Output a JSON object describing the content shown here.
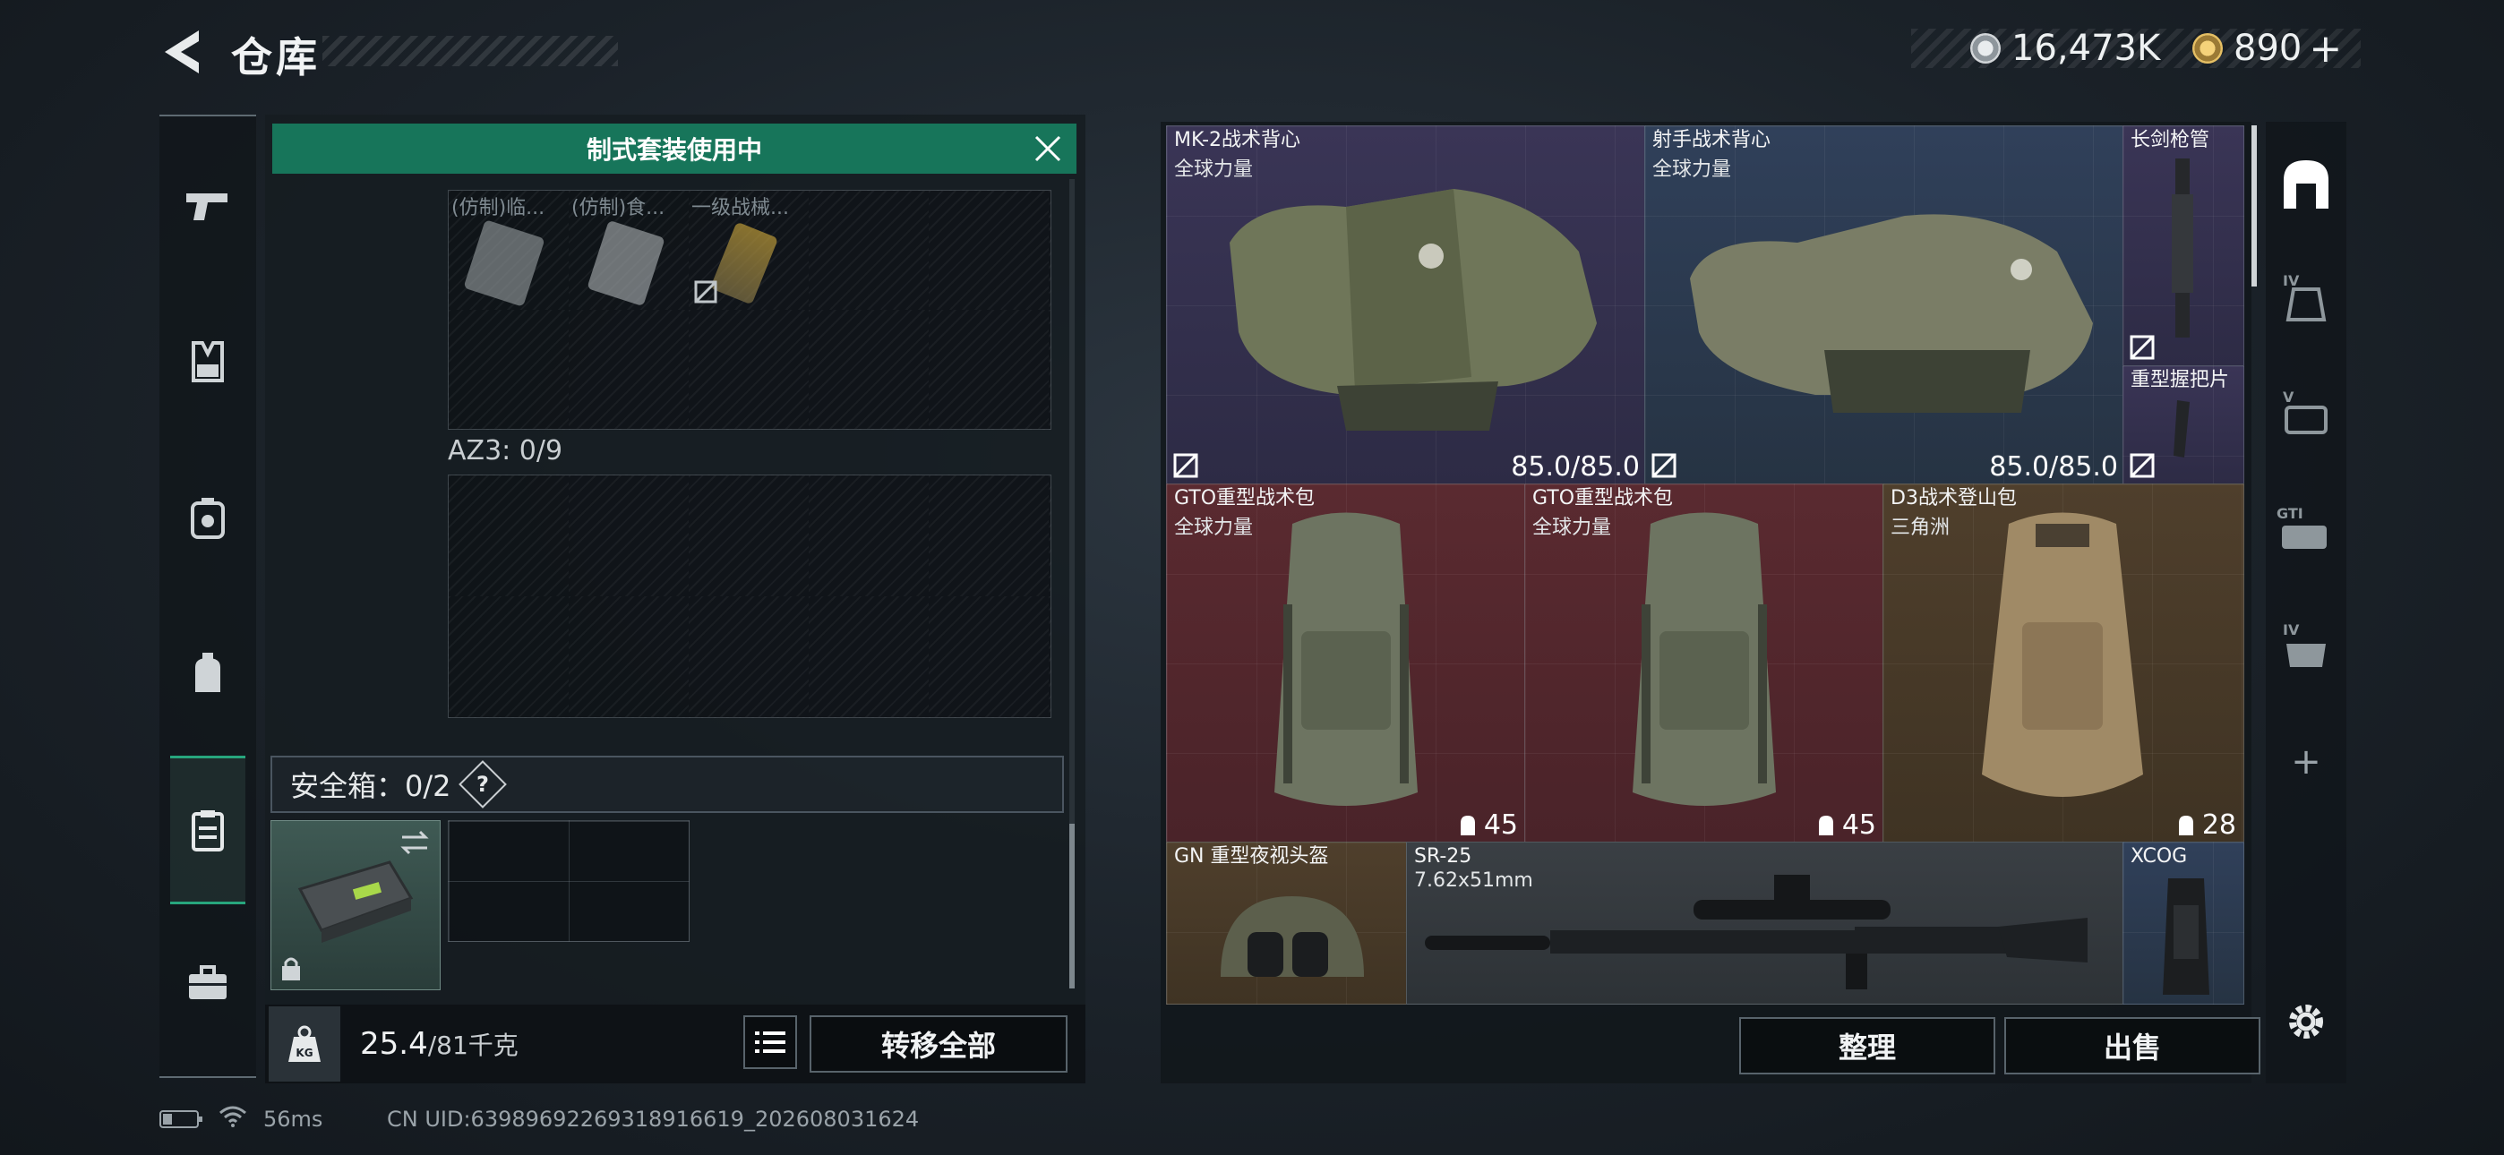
{
  "header": {
    "title": "仓库"
  },
  "currency": [
    {
      "icon": "silver-coin-icon",
      "value": "16,473K"
    },
    {
      "icon": "gold-coin-icon",
      "value": "890",
      "add_label": "+"
    }
  ],
  "left_rail": {
    "items": [
      {
        "name": "weapon",
        "icon": "pistol-icon"
      },
      {
        "name": "vest",
        "icon": "vest-icon"
      },
      {
        "name": "backpack-gear",
        "icon": "backpack-gear-icon"
      },
      {
        "name": "backpack",
        "icon": "backpack-icon"
      },
      {
        "name": "loadout",
        "icon": "clipboard-icon",
        "active": true
      },
      {
        "name": "case",
        "icon": "briefcase-icon"
      }
    ]
  },
  "left_panel": {
    "banner": "制式套装使用中",
    "top_slots": [
      "(仿制)临...",
      "(仿制)食...",
      "一级战械..."
    ],
    "az3_label": "AZ3: 0/9",
    "safebox_label": "安全箱：0/2",
    "safebox_help": "?",
    "weight_value": "25.4",
    "weight_max": "/81千克",
    "transfer_all": "转移全部"
  },
  "items": [
    {
      "name": "MK-2战术背心",
      "brand": "全球力量",
      "durability": "85.0/85.0",
      "rarity": "purple"
    },
    {
      "name": "射手战术背心",
      "brand": "全球力量",
      "durability": "85.0/85.0",
      "rarity": "blue"
    },
    {
      "name": "长剑枪管",
      "brand": "",
      "rarity": "purple"
    },
    {
      "name": "重型握把片",
      "brand": "",
      "rarity": "purple"
    },
    {
      "name": "GTO重型战术包",
      "brand": "全球力量",
      "count": "45",
      "rarity": "red"
    },
    {
      "name": "GTO重型战术包",
      "brand": "全球力量",
      "count": "45",
      "rarity": "red"
    },
    {
      "name": "D3战术登山包",
      "brand": "三角洲",
      "count": "28",
      "rarity": "gold"
    },
    {
      "name": "GN 重型夜视头盔",
      "brand": "",
      "rarity": "gold"
    },
    {
      "name": "SR-25",
      "brand": "7.62x51mm",
      "rarity": "gray"
    },
    {
      "name": "XCOG",
      "brand": "",
      "rarity": "blue"
    }
  ],
  "right_actions": {
    "sort": "整理",
    "sell": "出售"
  },
  "right_rail": {
    "items": [
      {
        "icon": "helmet-filter-icon",
        "label": ""
      },
      {
        "icon": "armor-filter-icon",
        "label": "IV"
      },
      {
        "icon": "ammo-filter-icon",
        "label": "V"
      },
      {
        "icon": "backpack-filter-icon",
        "label": "GTI"
      },
      {
        "icon": "parts-filter-icon",
        "label": "IV"
      }
    ],
    "add_label": "+"
  },
  "status_bar": {
    "ping": "56ms",
    "uid": "CN UID:6398969226931891661​9_202608031624"
  },
  "colors": {
    "accent_green": "#17755a",
    "purple": "#3a3556",
    "red": "#5a2a30",
    "gold": "#4f3f2c",
    "blue": "#30405a"
  }
}
